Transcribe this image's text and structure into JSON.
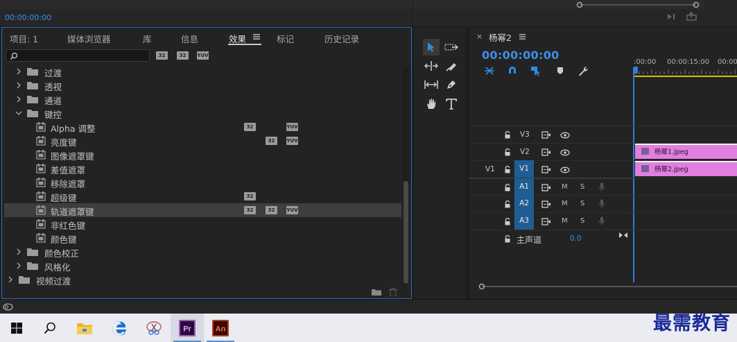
{
  "program_monitor": {
    "timecode": "00:00:00:00"
  },
  "effects_panel": {
    "tabs": [
      {
        "label": "项目: 1"
      },
      {
        "label": "媒体浏览器"
      },
      {
        "label": "库"
      },
      {
        "label": "信息"
      },
      {
        "label": "效果"
      },
      {
        "label": "标记"
      },
      {
        "label": "历史记录"
      }
    ],
    "active_tab": "效果",
    "search": {
      "value": "",
      "placeholder": ""
    },
    "filter_badges": [
      "32",
      "32",
      "YUV"
    ],
    "tree": [
      {
        "label": "过渡",
        "type": "folder",
        "expanded": false
      },
      {
        "label": "透视",
        "type": "folder",
        "expanded": false
      },
      {
        "label": "通道",
        "type": "folder",
        "expanded": false
      },
      {
        "label": "键控",
        "type": "folder",
        "expanded": true
      },
      {
        "label": "Alpha 调整",
        "type": "effect",
        "badges": [
          "32",
          "",
          "YUV"
        ]
      },
      {
        "label": "亮度键",
        "type": "effect",
        "badges": [
          "",
          "32",
          "YUV"
        ]
      },
      {
        "label": "图像遮罩键",
        "type": "effect",
        "badges": []
      },
      {
        "label": "差值遮罩",
        "type": "effect",
        "badges": []
      },
      {
        "label": "移除遮罩",
        "type": "effect",
        "badges": []
      },
      {
        "label": "超级键",
        "type": "effect",
        "badges": [
          "32",
          "",
          ""
        ]
      },
      {
        "label": "轨道遮罩键",
        "type": "effect",
        "badges": [
          "32",
          "32",
          "YUV"
        ],
        "selected": true
      },
      {
        "label": "非红色键",
        "type": "effect",
        "badges": []
      },
      {
        "label": "颜色键",
        "type": "effect",
        "badges": []
      },
      {
        "label": "颜色校正",
        "type": "folder",
        "expanded": false
      },
      {
        "label": "风格化",
        "type": "folder",
        "expanded": false
      },
      {
        "label": "视频过渡",
        "type": "folder",
        "expanded": false,
        "top_level": true
      }
    ]
  },
  "timeline": {
    "sequence_name": "杨幂2",
    "timecode": "00:00:00:00",
    "ruler_labels": [
      ":00:00",
      "00:00:15:00",
      "00:00"
    ],
    "video_tracks": [
      {
        "name": "V3",
        "source": "",
        "patched": false
      },
      {
        "name": "V2",
        "source": "",
        "patched": false
      },
      {
        "name": "V1",
        "source": "V1",
        "patched": true
      }
    ],
    "audio_tracks": [
      {
        "name": "A1",
        "patched": true
      },
      {
        "name": "A2",
        "patched": true
      },
      {
        "name": "A3",
        "patched": true
      }
    ],
    "mute_label": "M",
    "solo_label": "S",
    "master": {
      "label": "主声道",
      "value": "0.0"
    },
    "clips": [
      {
        "name": "杨幂1.jpeg",
        "track": "V2"
      },
      {
        "name": "杨幂2.jpeg",
        "track": "V1"
      }
    ]
  },
  "taskbar": {
    "apps": [
      "windows-start",
      "search",
      "file-explorer",
      "edge",
      "snipping",
      "premiere-pro",
      "animate"
    ],
    "premiere_label": "Pr",
    "animate_label": "An"
  },
  "watermark": "最需教育",
  "colors": {
    "accent": "#3d8fe6",
    "clip": "#e07fdf",
    "patched": "#1f5e93",
    "panel_border": "#2d6fc0"
  }
}
